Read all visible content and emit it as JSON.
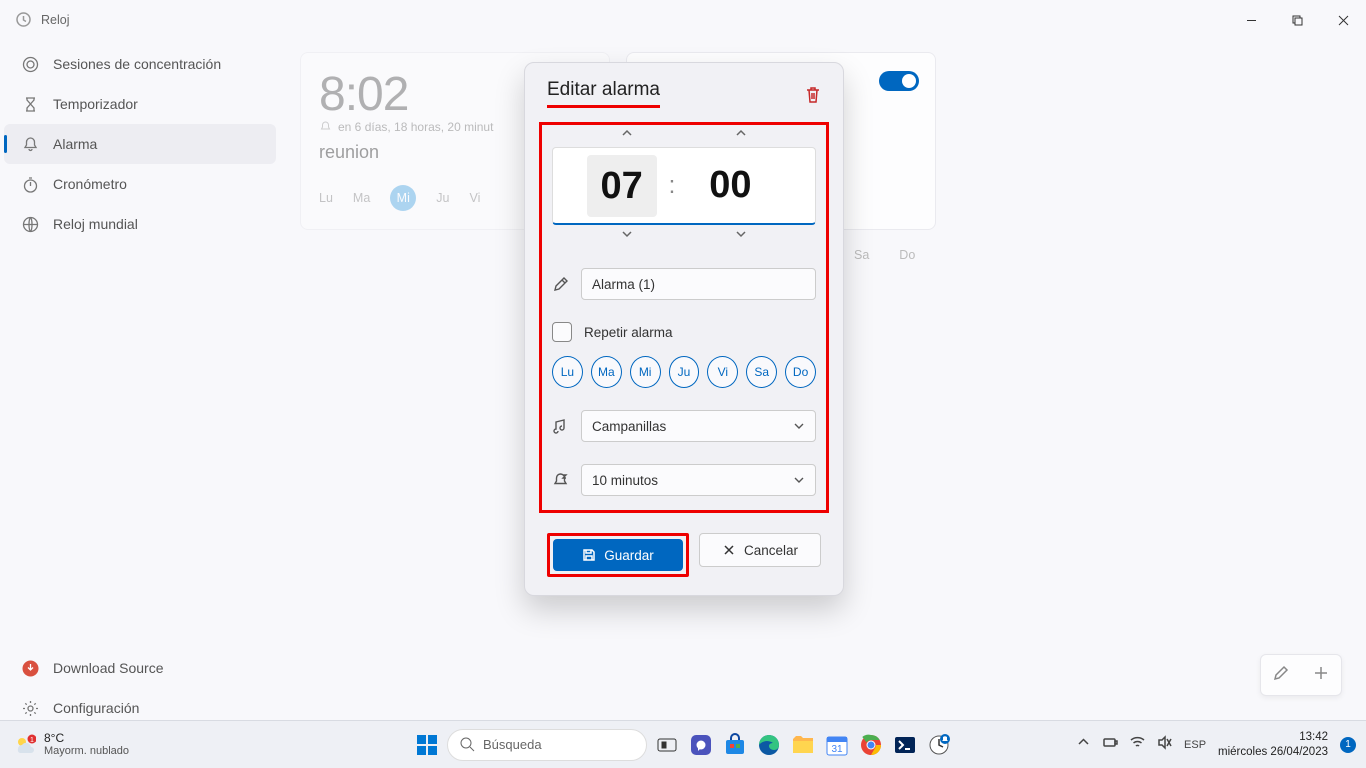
{
  "app": {
    "title": "Reloj"
  },
  "window_controls": {
    "min": "−",
    "max": "□",
    "close": "✕"
  },
  "sidebar": {
    "items": [
      {
        "label": "Sesiones de concentración"
      },
      {
        "label": "Temporizador"
      },
      {
        "label": "Alarma"
      },
      {
        "label": "Cronómetro"
      },
      {
        "label": "Reloj mundial"
      }
    ],
    "bottom": [
      {
        "label": "Download Source"
      },
      {
        "label": "Configuración"
      }
    ]
  },
  "card1": {
    "time": "8:02",
    "countdown": "en 6 días, 18 horas, 20 minut",
    "name": "reunion",
    "days": [
      "Lu",
      "Ma",
      "Mi",
      "Ju",
      "Vi"
    ]
  },
  "card2_days": [
    "Sa",
    "Do"
  ],
  "dialog": {
    "title": "Editar alarma",
    "hour": "07",
    "minute": "00",
    "name_value": "Alarma (1)",
    "repeat_label": "Repetir alarma",
    "days": [
      "Lu",
      "Ma",
      "Mi",
      "Ju",
      "Vi",
      "Sa",
      "Do"
    ],
    "sound": "Campanillas",
    "snooze": "10 minutos",
    "save": "Guardar",
    "cancel": "Cancelar"
  },
  "taskbar": {
    "temp": "8°C",
    "desc": "Mayorm. nublado",
    "search": "Búsqueda",
    "time": "13:42",
    "date": "miércoles 26/04/2023",
    "notif": "1",
    "badge": "1"
  }
}
